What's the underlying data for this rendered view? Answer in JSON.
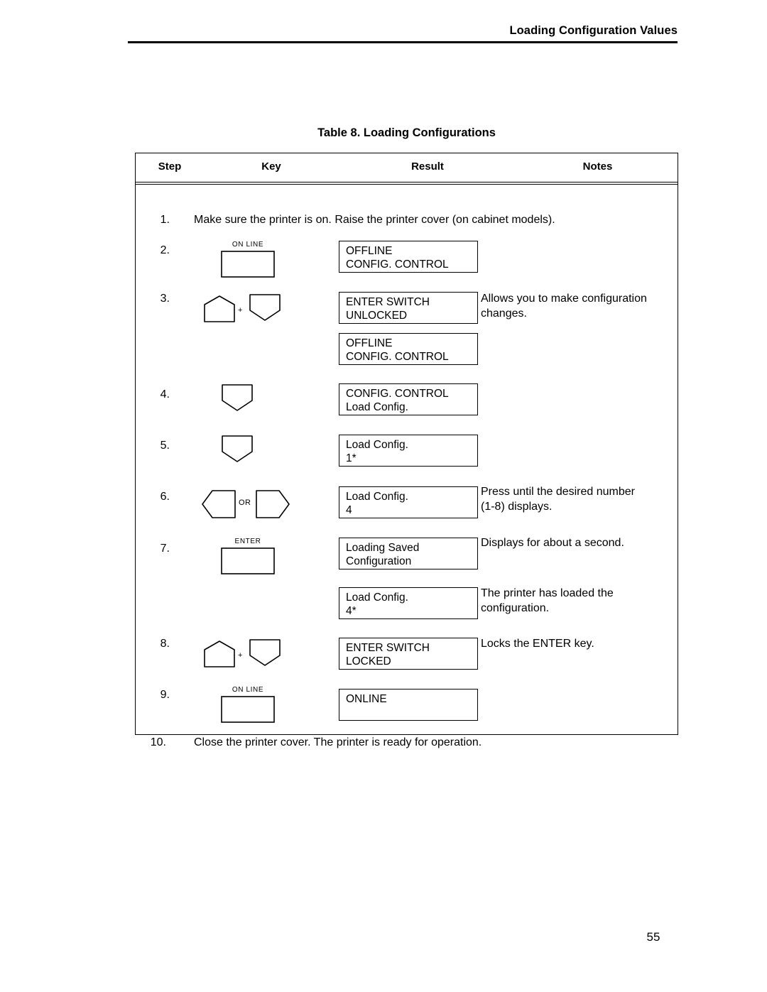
{
  "header": {
    "running_head": "Loading Configuration Values"
  },
  "caption": "Table 8. Loading Configurations",
  "table": {
    "columns": [
      "Step",
      "Key",
      "Result",
      "Notes"
    ],
    "rows": [
      {
        "step": "1.",
        "fulltext": "Make sure the printer is on. Raise the printer cover (on cabinet models).",
        "key": null,
        "results": [],
        "notes": []
      },
      {
        "step": "2.",
        "key": {
          "type": "labeled-button",
          "label": "ON LINE"
        },
        "results": [
          {
            "line1": "OFFLINE",
            "line2": "CONFIG. CONTROL"
          }
        ],
        "notes": []
      },
      {
        "step": "3.",
        "key": {
          "type": "combo",
          "first": "up-arrow-key",
          "connector": "+",
          "second": "down-arrow-key"
        },
        "results": [
          {
            "line1": "ENTER SWITCH",
            "line2": "UNLOCKED"
          },
          {
            "line1": "OFFLINE",
            "line2": "CONFIG. CONTROL"
          }
        ],
        "notes": [
          "Allows you to make configuration changes."
        ]
      },
      {
        "step": "4.",
        "key": {
          "type": "single",
          "first": "down-arrow-key"
        },
        "results": [
          {
            "line1": "CONFIG. CONTROL",
            "line2": "Load Config."
          }
        ],
        "notes": []
      },
      {
        "step": "5.",
        "key": {
          "type": "single",
          "first": "down-arrow-key"
        },
        "results": [
          {
            "line1": "Load Config.",
            "line2": "1*"
          }
        ],
        "notes": []
      },
      {
        "step": "6.",
        "key": {
          "type": "combo",
          "first": "left-arrow-key",
          "connector": "OR",
          "second": "right-arrow-key"
        },
        "results": [
          {
            "line1": "Load Config.",
            "line2": "4"
          }
        ],
        "notes": [
          "Press until the desired number (1-8) displays."
        ]
      },
      {
        "step": "7.",
        "key": {
          "type": "labeled-button",
          "label": "ENTER"
        },
        "results": [
          {
            "line1": "Loading Saved",
            "line2": "Configuration"
          },
          {
            "line1": "Load Config.",
            "line2": "4*"
          }
        ],
        "notes": [
          "Displays for about a second.",
          "The printer has loaded the configuration."
        ]
      },
      {
        "step": "8.",
        "key": {
          "type": "combo",
          "first": "up-arrow-key",
          "connector": "+",
          "second": "down-arrow-key"
        },
        "results": [
          {
            "line1": "ENTER SWITCH",
            "line2": "LOCKED"
          }
        ],
        "notes": [
          "Locks the ENTER key."
        ]
      },
      {
        "step": "9.",
        "key": {
          "type": "labeled-button",
          "label": "ON LINE"
        },
        "results": [
          {
            "line1": "ONLINE",
            "line2": ""
          }
        ],
        "notes": []
      },
      {
        "step": "10.",
        "fulltext": "Close the printer cover. The printer is ready for operation.",
        "key": null,
        "results": [],
        "notes": []
      }
    ]
  },
  "notes_text": {
    "n3_l1": "Allows you to make configuration",
    "n3_l2": "changes.",
    "n6_l1": "Press until the desired number",
    "n6_l2": "(1-8) displays.",
    "n7a": "Displays for about a second.",
    "n7b_l1": "The printer has loaded the",
    "n7b_l2": "configuration.",
    "n8": "Locks the ENTER key."
  },
  "page_number": "55"
}
